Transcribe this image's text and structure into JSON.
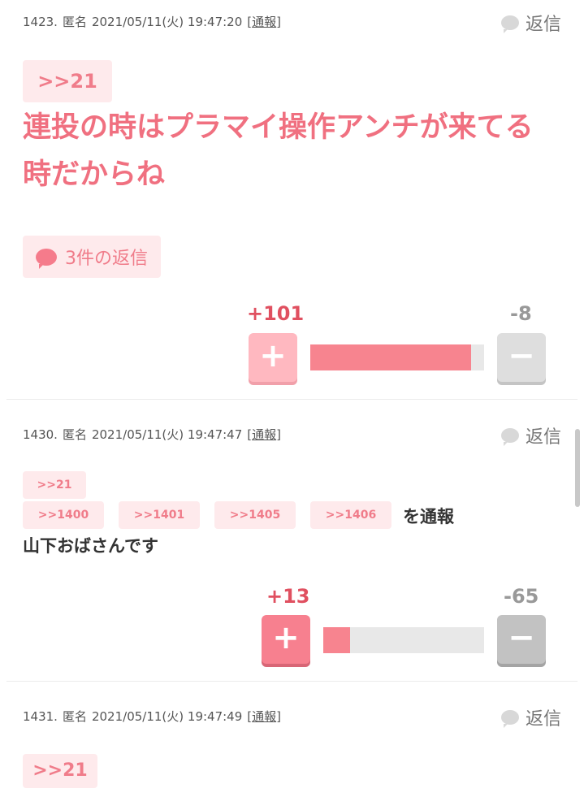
{
  "comments": [
    {
      "number": "1423.",
      "name": "匿名",
      "date": "2021/05/11(火) 19:47:20",
      "report_label": "通報",
      "reply_label": "返信",
      "anchor": ">>21",
      "text": "連投の時はプラマイ操作アンチが来てる時だからね",
      "replies_label": "3件の返信",
      "plus": "+101",
      "minus": "-8",
      "plus_ratio": 0.927
    },
    {
      "number": "1430.",
      "name": "匿名",
      "date": "2021/05/11(火) 19:47:47",
      "report_label": "通報",
      "reply_label": "返信",
      "anchor": ">>21",
      "anchors": [
        ">>1400",
        ">>1401",
        ">>1405",
        ">>1406"
      ],
      "anchors_suffix": "を通報",
      "text": "山下おばさんです",
      "plus": "+13",
      "minus": "-65",
      "plus_ratio": 0.167
    },
    {
      "number": "1431.",
      "name": "匿名",
      "date": "2021/05/11(火) 19:47:49",
      "report_label": "通報",
      "reply_label": "返信",
      "anchor": ">>21"
    }
  ],
  "icons": {
    "reply": "speech-bubble-icon",
    "plus": "plus-icon",
    "minus": "minus-icon"
  },
  "colors": {
    "accent": "#f07080",
    "anchor_bg": "#feeaec",
    "plus_bar": "#f7848f"
  }
}
